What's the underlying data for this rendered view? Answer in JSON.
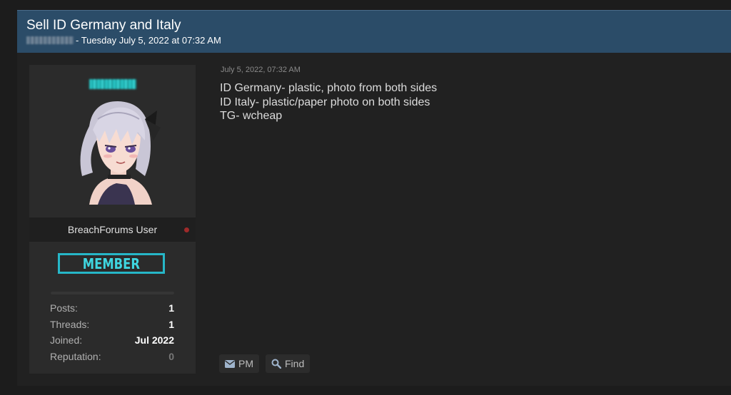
{
  "thread": {
    "title": "Sell ID Germany and Italy",
    "meta": "- Tuesday July 5, 2022 at 07:32 AM"
  },
  "user": {
    "usertitle": "BreachForums User",
    "badge": "MEMBER",
    "status_color": "#9e2a2a",
    "stats": [
      {
        "label": "Posts:",
        "value": "1"
      },
      {
        "label": "Threads:",
        "value": "1"
      },
      {
        "label": "Joined:",
        "value": "Jul 2022"
      },
      {
        "label": "Reputation:",
        "value": "0"
      }
    ]
  },
  "post": {
    "date": "July 5, 2022, 07:32 AM",
    "lines": [
      "ID Germany- plastic, photo from both sides",
      "ID Italy- plastic/paper photo on both sides",
      "TG- wcheap"
    ]
  },
  "buttons": {
    "pm": {
      "label": "PM",
      "icon": "envelope-icon"
    },
    "find": {
      "label": "Find",
      "icon": "search-icon"
    }
  },
  "colors": {
    "header_bg": "#2b4c68",
    "badge_accent": "#26b7c8"
  }
}
